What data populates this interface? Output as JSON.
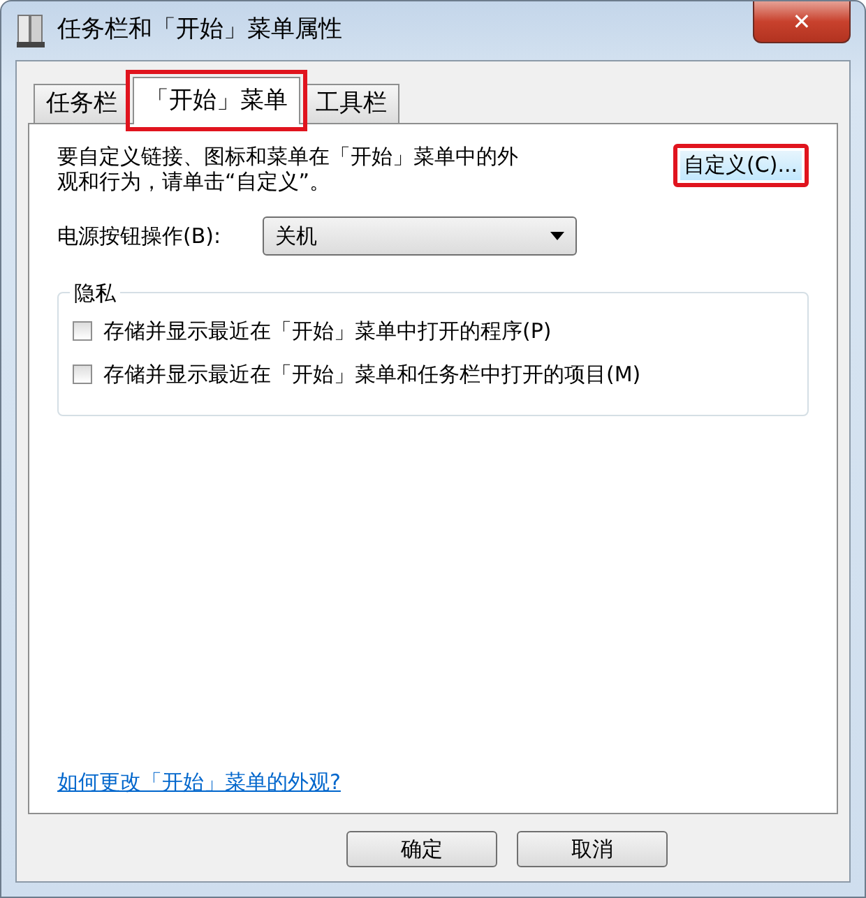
{
  "window": {
    "title": "任务栏和「开始」菜单属性",
    "close": "✕"
  },
  "tabs": [
    {
      "label": "任务栏",
      "selected": false,
      "highlighted": false
    },
    {
      "label": "「开始」菜单",
      "selected": true,
      "highlighted": true
    },
    {
      "label": "工具栏",
      "selected": false,
      "highlighted": false
    }
  ],
  "intro": {
    "text": "要自定义链接、图标和菜单在「开始」菜单中的外观和行为，请单击“自定义”。",
    "button": {
      "label": "自定义(C)...",
      "highlighted": true
    }
  },
  "power_button": {
    "label": "电源按钮操作(B):",
    "value": "关机"
  },
  "privacy": {
    "title": "隐私",
    "options": [
      {
        "label": "存储并显示最近在「开始」菜单中打开的程序(P)",
        "checked": false
      },
      {
        "label": "存储并显示最近在「开始」菜单和任务栏中打开的项目(M)",
        "checked": false
      }
    ]
  },
  "help_link": "如何更改「开始」菜单的外观?",
  "buttons": [
    "确定",
    "取消"
  ]
}
